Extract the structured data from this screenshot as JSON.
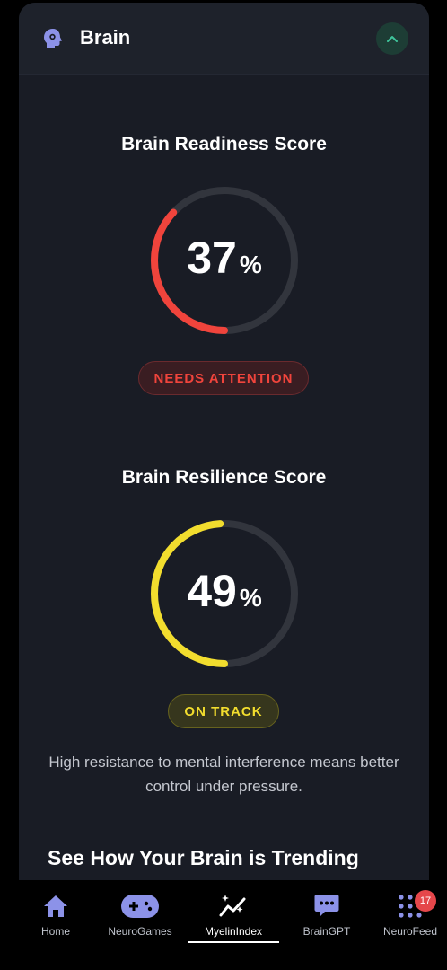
{
  "header": {
    "title": "Brain",
    "icon": "brain-head-icon",
    "collapse_icon": "chevron-up-icon"
  },
  "readiness": {
    "title": "Brain Readiness Score",
    "value": "37",
    "percent_value": 37,
    "unit": "%",
    "status": "NEEDS ATTENTION",
    "color": "#f0443c"
  },
  "resilience": {
    "title": "Brain Resilience Score",
    "value": "49",
    "percent_value": 49,
    "unit": "%",
    "status": "ON TRACK",
    "color": "#f2dd2e",
    "description": "High resistance to mental interference means better control under pressure."
  },
  "trend": {
    "title": "See How Your Brain is Trending"
  },
  "colors": {
    "track": "#32353d",
    "accent": "#8c92e8",
    "card_bg": "#191c25"
  },
  "nav": {
    "items": [
      {
        "label": "Home",
        "icon": "home-icon"
      },
      {
        "label": "NeuroGames",
        "icon": "gamepad-icon"
      },
      {
        "label": "MyelinIndex",
        "icon": "sparkle-chart-icon",
        "active": true
      },
      {
        "label": "BrainGPT",
        "icon": "chat-icon"
      },
      {
        "label": "NeuroFeed",
        "icon": "grid-dots-icon",
        "badge": "17"
      }
    ]
  }
}
